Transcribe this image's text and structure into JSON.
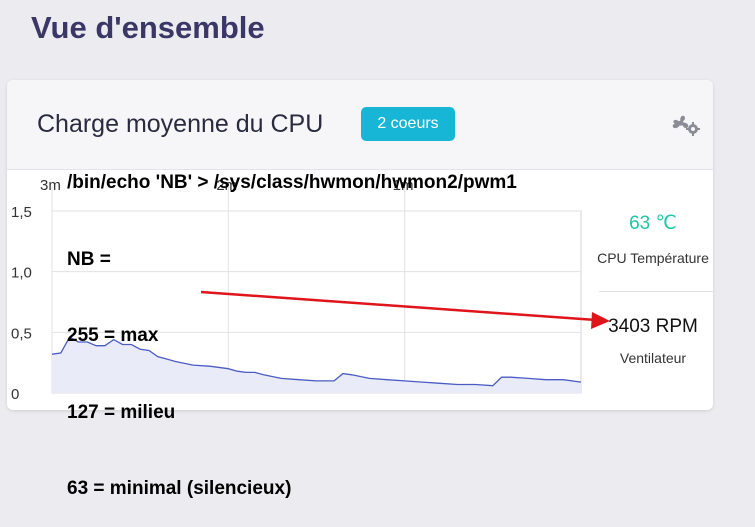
{
  "page": {
    "title": "Vue d'ensemble"
  },
  "card": {
    "title": "Charge moyenne du CPU",
    "badge": "2 coeurs",
    "settings_icon": "fan-gear-icon"
  },
  "annotation": {
    "lines": [
      "/bin/echo 'NB' > /sys/class/hwmon/hwmon2/pwm1",
      "NB =",
      "255 = max",
      "127 = milieu",
      "63 = minimal (silencieux)"
    ],
    "arrow_color": "#e0141b"
  },
  "sidebar": {
    "temperature_value": "63 ℃",
    "temperature_label": "CPU Température",
    "fan_value": "3403 RPM",
    "fan_label": "Ventilateur"
  },
  "colors": {
    "title": "#3a3766",
    "badge": "#18b6d6",
    "temperature": "#1ec7a8",
    "line": "#4a5cc4",
    "fill": "#e9ebf8"
  },
  "chart_data": {
    "type": "area",
    "x_ticks": [
      "3m",
      "2m",
      "1m"
    ],
    "y_ticks": [
      "1,5",
      "1,0",
      "0,5",
      "0"
    ],
    "ylim": [
      0,
      1.5
    ],
    "x_minutes_ago": [
      3.0,
      2.95,
      2.9,
      2.85,
      2.8,
      2.75,
      2.7,
      2.65,
      2.6,
      2.55,
      2.5,
      2.45,
      2.4,
      2.35,
      2.3,
      2.2,
      2.1,
      2.0,
      1.95,
      1.9,
      1.85,
      1.8,
      1.7,
      1.6,
      1.5,
      1.4,
      1.35,
      1.3,
      1.2,
      1.1,
      1.0,
      0.9,
      0.8,
      0.7,
      0.6,
      0.5,
      0.45,
      0.4,
      0.3,
      0.2,
      0.1,
      0.0
    ],
    "values": [
      0.32,
      0.33,
      0.46,
      0.42,
      0.42,
      0.39,
      0.39,
      0.44,
      0.4,
      0.4,
      0.36,
      0.35,
      0.3,
      0.28,
      0.26,
      0.23,
      0.22,
      0.2,
      0.18,
      0.17,
      0.17,
      0.15,
      0.12,
      0.11,
      0.1,
      0.1,
      0.16,
      0.15,
      0.12,
      0.11,
      0.1,
      0.09,
      0.08,
      0.07,
      0.07,
      0.06,
      0.13,
      0.13,
      0.12,
      0.11,
      0.11,
      0.09
    ]
  }
}
